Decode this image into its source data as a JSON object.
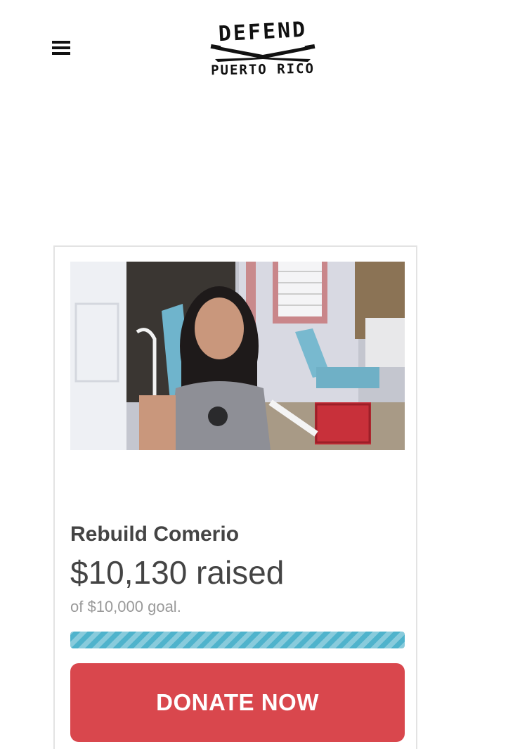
{
  "header": {
    "menu_icon": "hamburger-menu-icon",
    "logo": {
      "line1": "DEFEND",
      "line2": "PUERTO RICO",
      "emblem": "crossed-machetes"
    }
  },
  "campaign": {
    "title": "Rebuild Comerio",
    "raised": "$10,130 raised",
    "goal": "of $10,000 goal.",
    "progress_fraction": 1.0,
    "progress_color": "#4fb3cc",
    "donate_label": "DONATE NOW",
    "donate_color": "#d9474d",
    "photo_alt": "Girl sitting outside her home in Comerio"
  }
}
